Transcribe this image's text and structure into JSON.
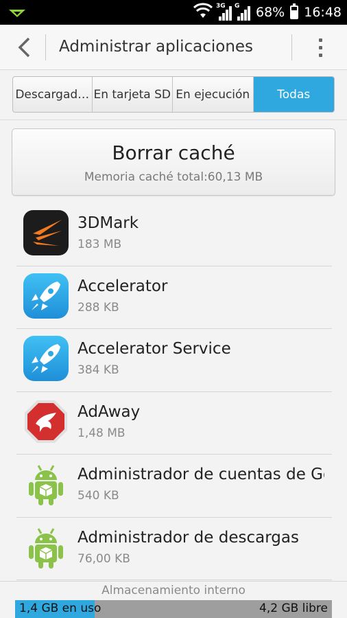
{
  "status_bar": {
    "network_1": "3G",
    "network_2": "G",
    "battery": "68%",
    "time": "16:48",
    "icons": [
      "notification-icon",
      "wifi-icon",
      "signal-icon",
      "signal-icon",
      "battery-icon"
    ]
  },
  "header": {
    "title": "Administrar aplicaciones",
    "back_icon": "chevron-left-icon",
    "menu_icon": "more-vert-icon"
  },
  "tabs": [
    {
      "label": "Descargad…",
      "active": false
    },
    {
      "label": "En tarjeta SD",
      "active": false
    },
    {
      "label": "En ejecución",
      "active": false
    },
    {
      "label": "Todas",
      "active": true
    }
  ],
  "cache": {
    "title": "Borrar caché",
    "subtitle": "Memoria caché total:60,13 MB"
  },
  "apps": [
    {
      "name": "3DMark",
      "size": "183 MB",
      "icon": "3dmark-icon"
    },
    {
      "name": "Accelerator",
      "size": "288 KB",
      "icon": "rocket-icon"
    },
    {
      "name": "Accelerator Service",
      "size": "384 KB",
      "icon": "rocket-icon"
    },
    {
      "name": "AdAway",
      "size": "1,48 MB",
      "icon": "adaway-icon"
    },
    {
      "name": "Administrador de cuentas de Google",
      "size": "540 KB",
      "icon": "android-icon"
    },
    {
      "name": "Administrador de descargas",
      "size": "76,00 KB",
      "icon": "android-icon"
    }
  ],
  "storage": {
    "label": "Almacenamiento interno",
    "used": "1,4 GB en uso",
    "free": "4,2 GB libre",
    "used_fraction": 0.25
  },
  "colors": {
    "accent": "#2ea8de",
    "status_bar": "#000000",
    "background": "#f3f3f3"
  }
}
